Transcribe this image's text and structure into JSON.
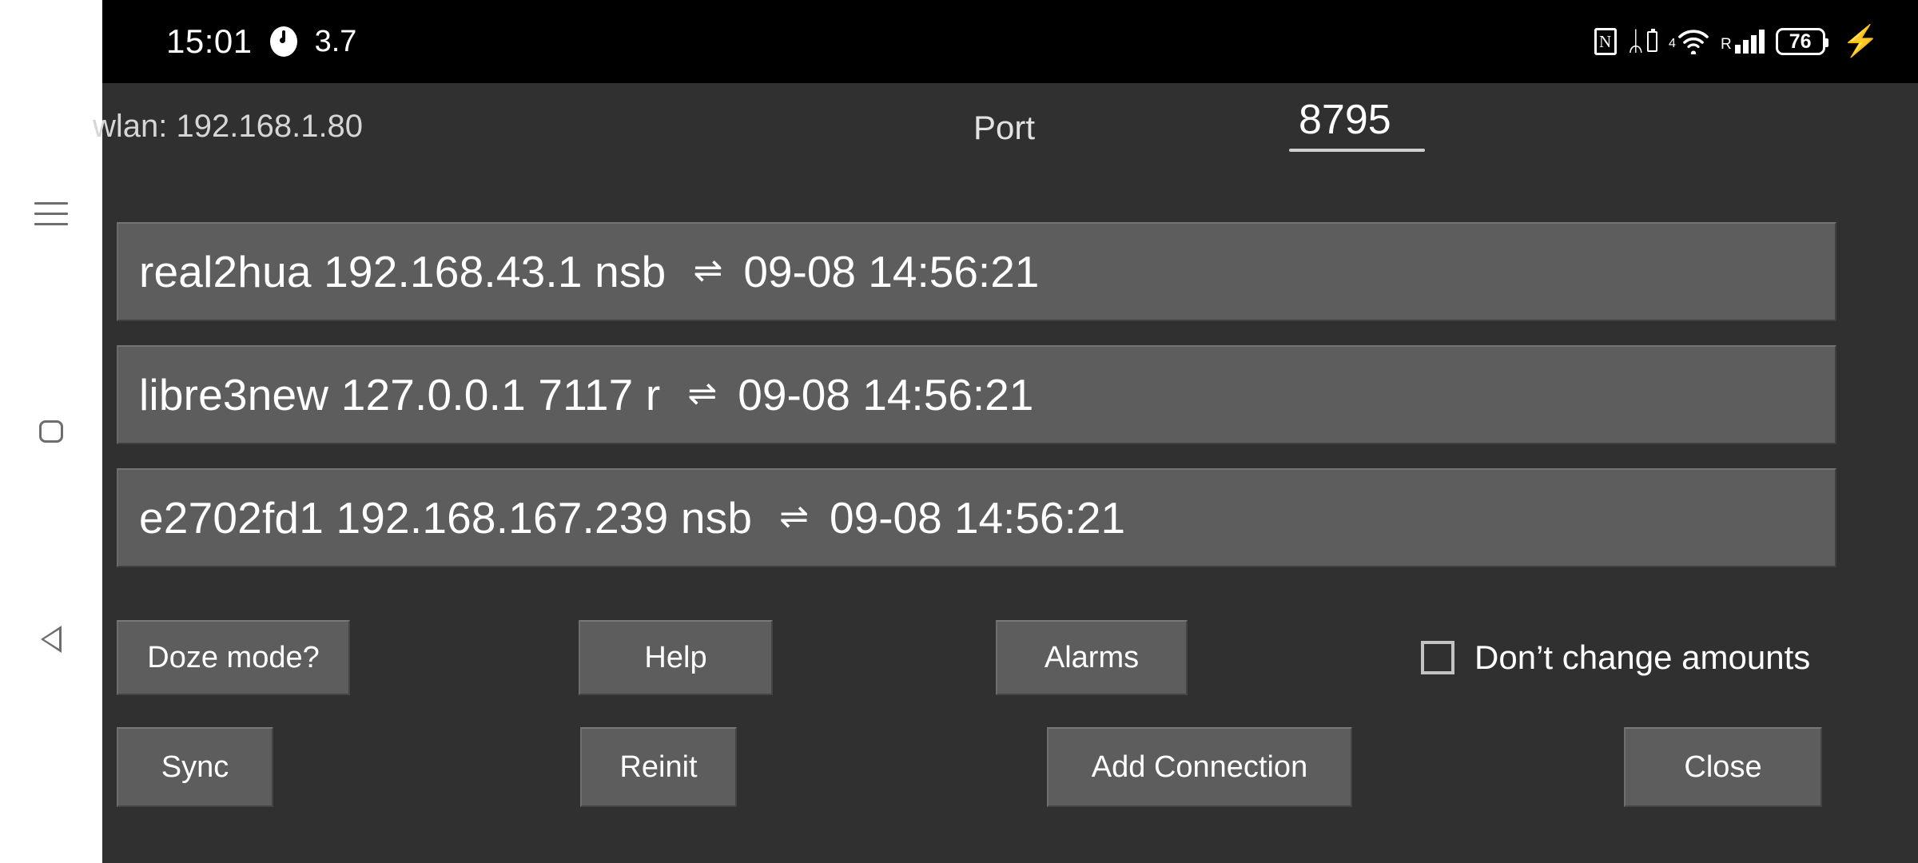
{
  "statusbar": {
    "clock": "15:01",
    "clock_icon": "clock-face-icon",
    "level": "3.7",
    "nfc_letter": "N",
    "bluetooth_glyph": "ᛦ",
    "wifi_network_type": "4",
    "wifi_glyph": "◠",
    "roaming_letter": "R",
    "battery_percent": "76",
    "charging_glyph": "⚡"
  },
  "header": {
    "wlan": "wlan: 192.168.1.80",
    "port_label": "Port",
    "port_value": "8795"
  },
  "connections": [
    {
      "name": "real2hua 192.168.43.1 nsb",
      "arrows": "⇌",
      "time": "09-08 14:56:21"
    },
    {
      "name": "libre3new 127.0.0.1 7117 r",
      "arrows": "⇌",
      "time": "09-08 14:56:21"
    },
    {
      "name": "e2702fd1 192.168.167.239 nsb",
      "arrows": "⇌",
      "time": "09-08 14:56:21"
    }
  ],
  "controls": {
    "doze_mode": "Doze mode?",
    "help": "Help",
    "alarms": "Alarms",
    "dont_change_amounts": "Don’t change amounts",
    "dont_change_amounts_checked": false,
    "sync": "Sync",
    "reinit": "Reinit",
    "add_connection": "Add Connection",
    "close": "Close"
  },
  "navbar": {
    "recents": "recents-menu-icon",
    "home": "home-square-icon",
    "back": "back-triangle-icon"
  },
  "colors": {
    "app_background": "#303030",
    "statusbar_background": "#000000",
    "row_background": "#5d5d5d",
    "button_background": "#5d5d5d",
    "navbar_background": "#ffffff",
    "text_primary": "#ffffff"
  }
}
